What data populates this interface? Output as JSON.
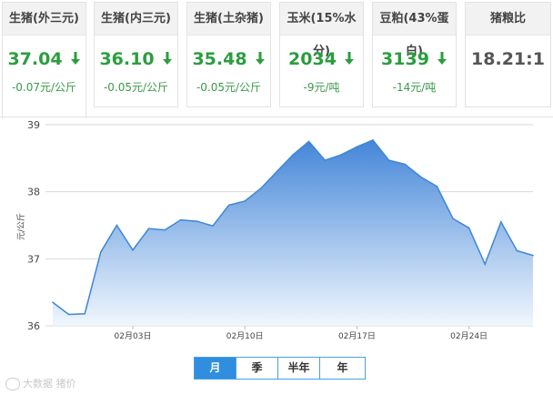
{
  "cards": [
    {
      "title": "生猪(外三元)",
      "value": "37.04",
      "change": "-0.07元/公斤",
      "trend": "down"
    },
    {
      "title": "生猪(内三元)",
      "value": "36.10",
      "change": "-0.05元/公斤",
      "trend": "down"
    },
    {
      "title": "生猪(土杂猪)",
      "value": "35.48",
      "change": "-0.05元/公斤",
      "trend": "down"
    },
    {
      "title": "玉米(15%水分)",
      "value": "2034",
      "change": "-9元/吨",
      "trend": "down"
    },
    {
      "title": "豆粕(43%蛋白)",
      "value": "3139",
      "change": "-14元/吨",
      "trend": "down"
    },
    {
      "title": "猪粮比",
      "value": "18.21:1",
      "change": "",
      "trend": "none"
    }
  ],
  "colors": {
    "down": "#2a9e3e",
    "line": "#3e86d8",
    "fill_top": "#3a7fd6",
    "fill_bottom": "#eef5fd",
    "tab_active": "#2f8ee0"
  },
  "chart_data": {
    "type": "area",
    "xlabel": "",
    "ylabel": "元/公斤",
    "ylim": [
      36,
      39
    ],
    "yticks": [
      "36",
      "37",
      "38",
      "39"
    ],
    "xticks": [
      "02月03日",
      "02月10日",
      "02月17日",
      "02月24日"
    ],
    "grid": true,
    "series": [
      {
        "values": [
          36.35,
          36.17,
          36.18,
          37.1,
          37.5,
          37.13,
          37.45,
          37.43,
          37.58,
          37.56,
          37.49,
          37.8,
          37.86,
          38.05,
          38.3,
          38.55,
          38.75,
          38.47,
          38.55,
          38.67,
          38.77,
          38.47,
          38.41,
          38.22,
          38.08,
          37.6,
          37.46,
          36.92,
          37.55,
          37.12,
          37.05
        ]
      }
    ]
  },
  "tabs": [
    "月",
    "季",
    "半年",
    "年"
  ],
  "active_tab": "月",
  "watermark": "大数据 猪价"
}
